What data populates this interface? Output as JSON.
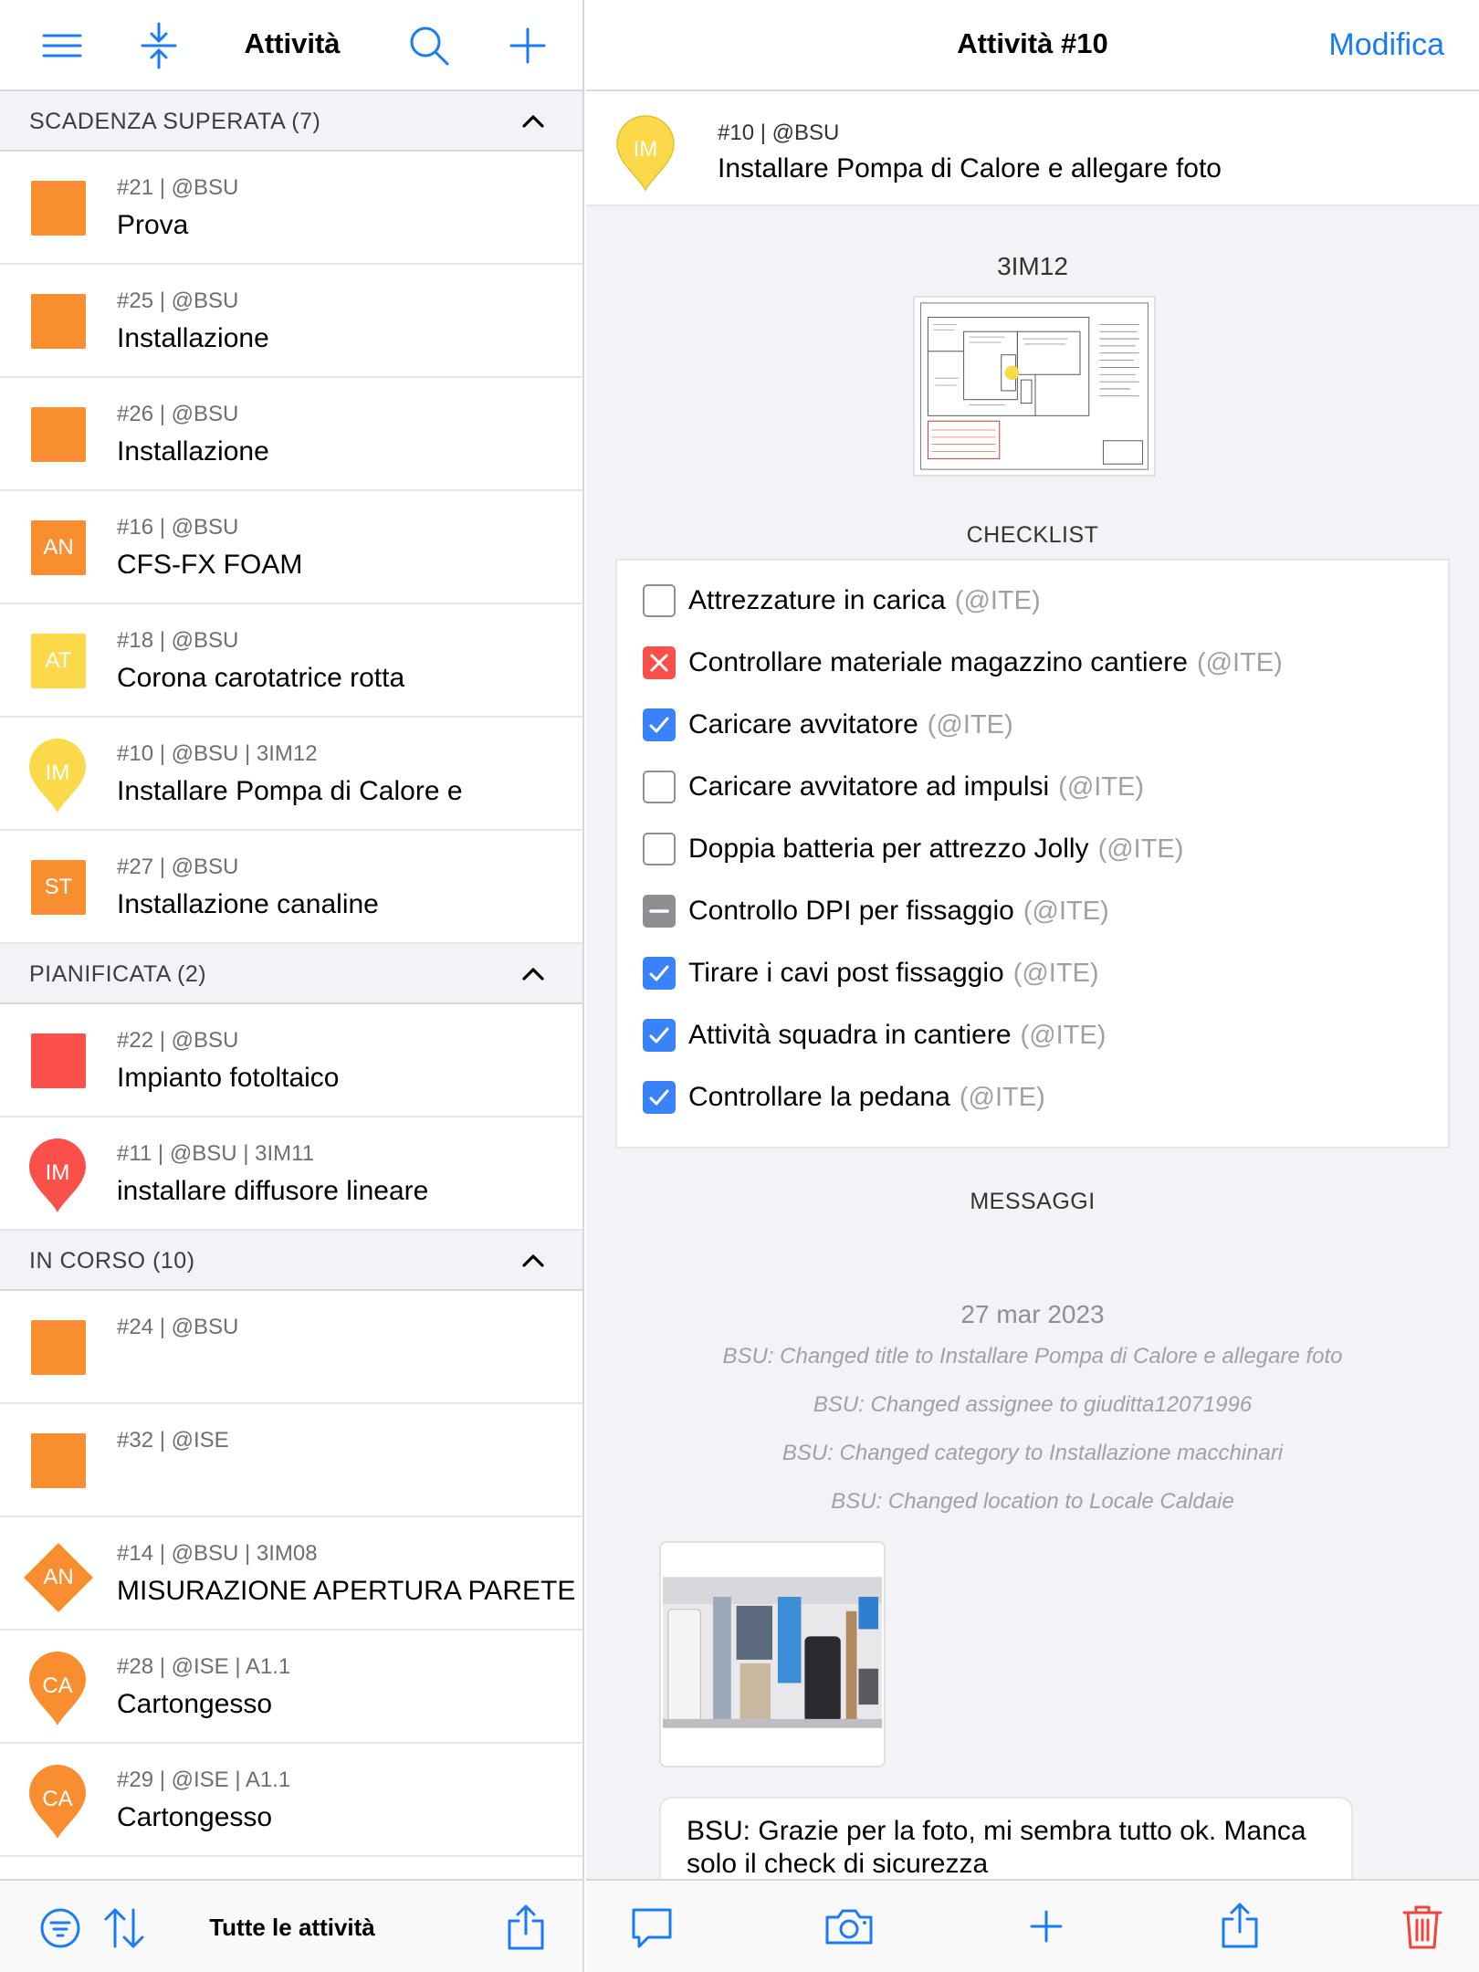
{
  "left": {
    "title": "Attività",
    "footer_title": "Tutte le attività",
    "header_icons": [
      "menu-icon",
      "collapse-icon",
      "search-icon",
      "add-icon"
    ],
    "footer_icons": [
      "filter-icon",
      "sort-icon",
      "share-icon"
    ],
    "sections": [
      {
        "title": "SCADENZA SUPERATA (7)",
        "items": [
          {
            "meta": "#21 | @BSU",
            "name": "Prova",
            "badge": {
              "shape": "square",
              "color": "#f98e30",
              "text": ""
            }
          },
          {
            "meta": "#25 | @BSU",
            "name": "Installazione",
            "badge": {
              "shape": "square",
              "color": "#f98e30",
              "text": ""
            }
          },
          {
            "meta": "#26 | @BSU",
            "name": "Installazione",
            "badge": {
              "shape": "square",
              "color": "#f98e30",
              "text": ""
            }
          },
          {
            "meta": "#16 | @BSU",
            "name": "CFS-FX FOAM",
            "badge": {
              "shape": "square",
              "color": "#f98e30",
              "text": "AN"
            }
          },
          {
            "meta": "#18 | @BSU",
            "name": "Corona carotatrice rotta",
            "badge": {
              "shape": "square",
              "color": "#fbd94a",
              "text": "AT"
            }
          },
          {
            "meta": "#10 | @BSU | 3IM12",
            "name": "Installare Pompa di Calore e",
            "badge": {
              "shape": "pin",
              "color": "#fbd94a",
              "text": "IM"
            }
          },
          {
            "meta": "#27 | @BSU",
            "name": "Installazione canaline",
            "badge": {
              "shape": "square",
              "color": "#f98e30",
              "text": "ST"
            }
          }
        ]
      },
      {
        "title": "PIANIFICATA (2)",
        "items": [
          {
            "meta": "#22 | @BSU",
            "name": "Impianto fotoltaico",
            "badge": {
              "shape": "square",
              "color": "#f9504a",
              "text": ""
            }
          },
          {
            "meta": "#11 | @BSU | 3IM11",
            "name": "installare diffusore lineare",
            "badge": {
              "shape": "pin",
              "color": "#f9504a",
              "text": "IM"
            }
          }
        ]
      },
      {
        "title": "IN CORSO (10)",
        "items": [
          {
            "meta": "#24 | @BSU",
            "name": "",
            "badge": {
              "shape": "square",
              "color": "#f98e30",
              "text": ""
            }
          },
          {
            "meta": "#32 | @ISE",
            "name": "",
            "badge": {
              "shape": "square",
              "color": "#f98e30",
              "text": ""
            }
          },
          {
            "meta": "#14 | @BSU | 3IM08",
            "name": "MISURAZIONE APERTURA PARETE",
            "badge": {
              "shape": "diamond",
              "color": "#f98e30",
              "text": "AN"
            }
          },
          {
            "meta": "#28 | @ISE | A1.1",
            "name": "Cartongesso",
            "badge": {
              "shape": "pin",
              "color": "#f98e30",
              "text": "CA"
            }
          },
          {
            "meta": "#29 | @ISE | A1.1",
            "name": "Cartongesso",
            "badge": {
              "shape": "pin",
              "color": "#f98e30",
              "text": "CA"
            }
          }
        ]
      }
    ]
  },
  "right": {
    "title": "Attività #10",
    "edit_label": "Modifica",
    "task": {
      "meta": "#10 | @BSU",
      "name": "Installare Pompa di Calore e allegare foto",
      "badge_text": "IM",
      "badge_color": "#fbd94a"
    },
    "location": "3IM12",
    "checklist_title": "CHECKLIST",
    "checklist": [
      {
        "text": "Attrezzature in carica",
        "assignee": "(@ITE)",
        "state": "unchecked"
      },
      {
        "text": "Controllare materiale magazzino cantiere",
        "assignee": "(@ITE)",
        "state": "failed"
      },
      {
        "text": "Caricare avvitatore",
        "assignee": "(@ITE)",
        "state": "checked"
      },
      {
        "text": "Caricare avvitatore ad impulsi",
        "assignee": "(@ITE)",
        "state": "unchecked"
      },
      {
        "text": "Doppia batteria per attrezzo Jolly",
        "assignee": "(@ITE)",
        "state": "unchecked"
      },
      {
        "text": "Controllo DPI per fissaggio",
        "assignee": "(@ITE)",
        "state": "na"
      },
      {
        "text": "Tirare i cavi post fissaggio",
        "assignee": "(@ITE)",
        "state": "checked"
      },
      {
        "text": "Attività squadra in cantiere",
        "assignee": "(@ITE)",
        "state": "checked"
      },
      {
        "text": "Controllare la pedana",
        "assignee": "(@ITE)",
        "state": "checked"
      }
    ],
    "messages_title": "MESSAGGI",
    "message_date": "27 mar 2023",
    "system_messages": [
      "BSU: Changed title to Installare Pompa di Calore e allegare foto",
      "BSU: Changed assignee to giuditta12071996",
      "BSU: Changed category to Installazione macchinari",
      "BSU: Changed location to Locale Caldaie"
    ],
    "chat_message": "BSU: Grazie per la foto, mi sembra tutto ok. Manca solo il check di sicurezza",
    "footer_icons": [
      "comment-icon",
      "camera-icon",
      "add-icon",
      "share-icon",
      "trash-icon"
    ]
  },
  "colors": {
    "accent": "#1a7cf5",
    "orange": "#f98e30",
    "red": "#f9504a",
    "yellow": "#fbd94a",
    "check_blue": "#3a82f7",
    "trash_red": "#f0433a"
  }
}
